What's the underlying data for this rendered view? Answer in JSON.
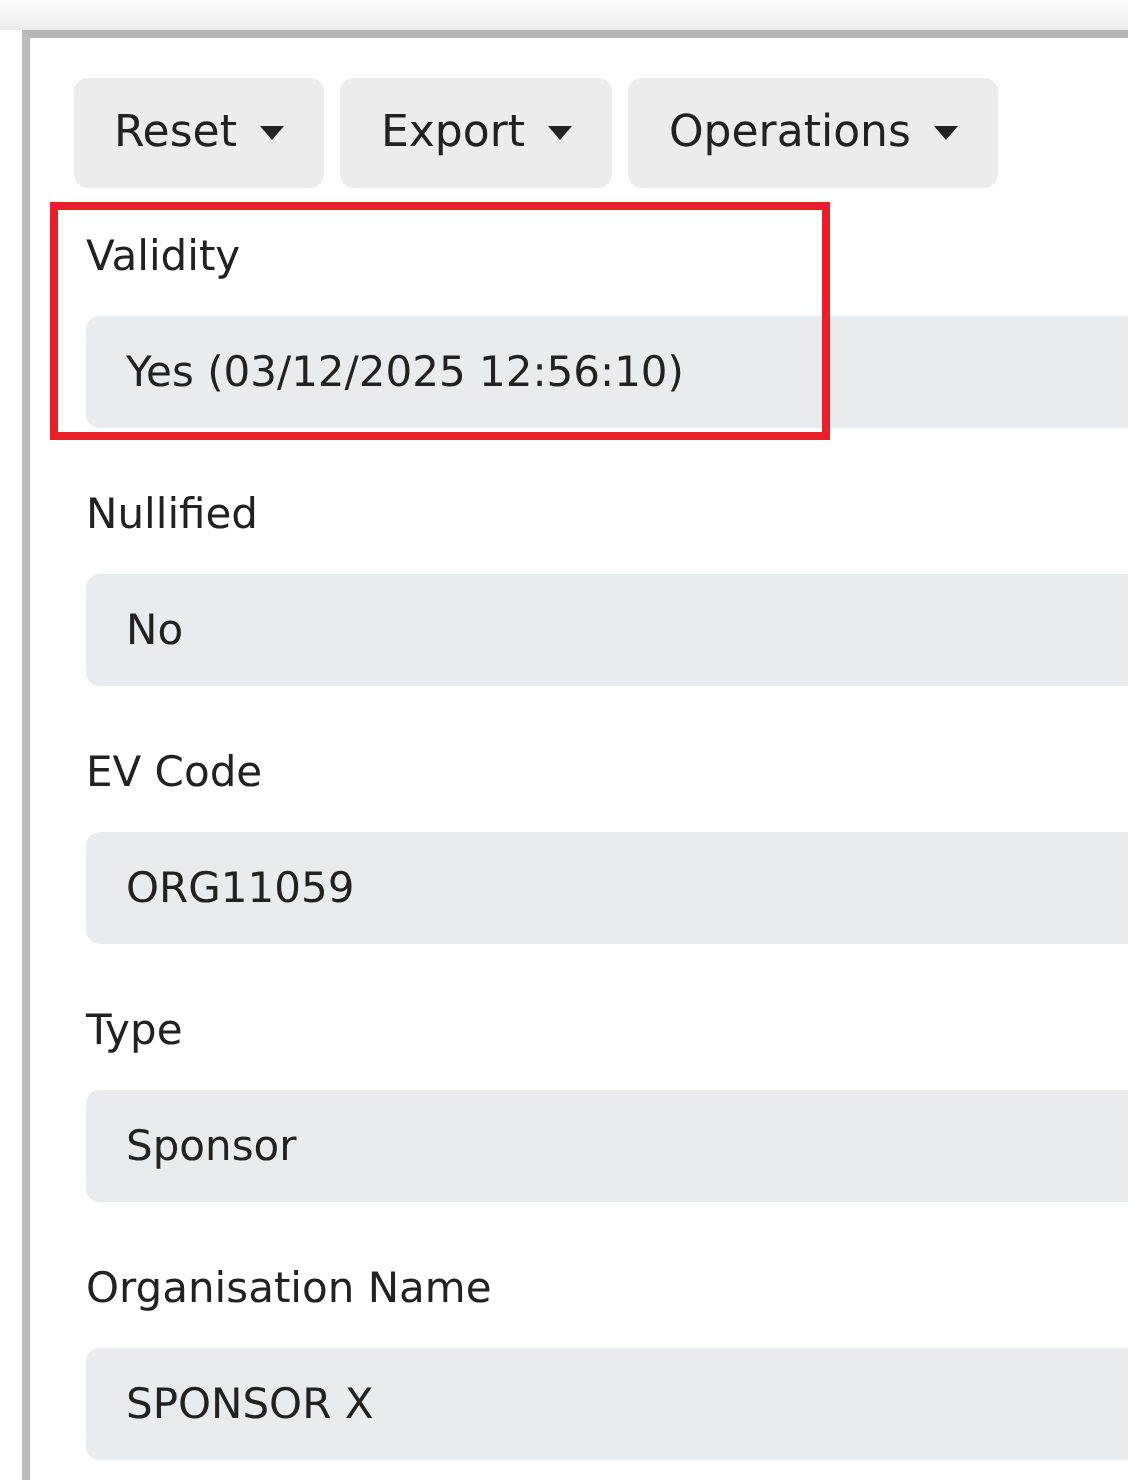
{
  "toolbar": [
    {
      "label": "Reset"
    },
    {
      "label": "Export"
    },
    {
      "label": "Operations"
    }
  ],
  "fields": [
    {
      "label": "Validity",
      "value": "Yes (03/12/2025 12:56:10)",
      "highlighted": true
    },
    {
      "label": "Nullified",
      "value": "No",
      "highlighted": false
    },
    {
      "label": "EV Code",
      "value": "ORG11059",
      "highlighted": false
    },
    {
      "label": "Type",
      "value": "Sponsor",
      "highlighted": false
    },
    {
      "label": "Organisation Name",
      "value": "SPONSOR X",
      "highlighted": false
    }
  ]
}
